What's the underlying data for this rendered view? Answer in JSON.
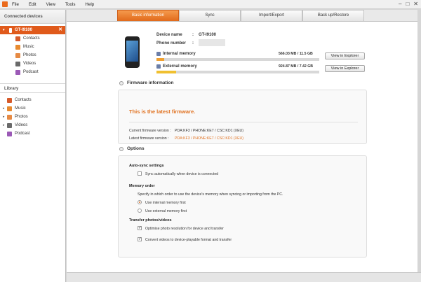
{
  "menubar": {
    "items": [
      "File",
      "Edit",
      "View",
      "Tools",
      "Help"
    ]
  },
  "window_controls": {
    "minimize": "–",
    "maximize": "□",
    "close": "✕"
  },
  "sidebar": {
    "connected_header": "Connected devices",
    "device": {
      "name": "GT-I9100",
      "close_glyph": "✕"
    },
    "device_items": [
      {
        "label": "Contacts",
        "icon": "contacts-icon",
        "color": "#d65a2a"
      },
      {
        "label": "Music",
        "icon": "music-icon",
        "color": "#e88a2f"
      },
      {
        "label": "Photos",
        "icon": "photos-icon",
        "color": "#e68a44"
      },
      {
        "label": "Videos",
        "icon": "videos-icon",
        "color": "#6a6a6a"
      },
      {
        "label": "Podcast",
        "icon": "podcast-icon",
        "color": "#9b59b6"
      }
    ],
    "library_header": "Library",
    "library_items": [
      {
        "label": "Contacts",
        "icon": "contacts-icon",
        "color": "#d65a2a",
        "expandable": false
      },
      {
        "label": "Music",
        "icon": "music-icon",
        "color": "#e88a2f",
        "expandable": true
      },
      {
        "label": "Photos",
        "icon": "photos-icon",
        "color": "#e68a44",
        "expandable": true
      },
      {
        "label": "Videos",
        "icon": "videos-icon",
        "color": "#6a6a6a",
        "expandable": true
      },
      {
        "label": "Podcast",
        "icon": "podcast-icon",
        "color": "#9b59b6",
        "expandable": false
      }
    ]
  },
  "tabs": [
    {
      "label": "Basic information",
      "active": true
    },
    {
      "label": "Sync",
      "active": false
    },
    {
      "label": "Import/Export",
      "active": false
    },
    {
      "label": "Back up/Restore",
      "active": false
    }
  ],
  "device_info": {
    "name_label": "Device name",
    "name_value": "GT-I9100",
    "phone_label": "Phone number",
    "separator": ":"
  },
  "memory": {
    "internal": {
      "label": "Internal memory",
      "value": "566.03 MB / 11.5 GB",
      "fill_fraction": 0.049,
      "color": "#f0a030"
    },
    "external": {
      "label": "External memory",
      "value": "924.87 MB / 7.42 GB",
      "fill_fraction": 0.122,
      "color": "#f0c030"
    }
  },
  "buttons": {
    "view_explorer_1": "View in Explorer",
    "view_explorer_2": "View in Explorer"
  },
  "firmware": {
    "section_title": "Firmware information",
    "status": "This is the latest firmware.",
    "current_label": "Current firmware version :",
    "current_value": "PDA:KF3 / PHONE:KE7 / CSC:KD1 (XEU)",
    "latest_label": "Latest firmware version :",
    "latest_value": "PDA:KF3 / PHONE:KE7 / CSC:KD1 (XEU)"
  },
  "options": {
    "section_title": "Options",
    "autosync_title": "Auto-sync settings",
    "autosync_label": "Sync automatically when device is connected",
    "autosync_checked": false,
    "memory_order_title": "Memory order",
    "memory_order_desc": "Specify in which order to use the device's memory when syncing or importing from the PC.",
    "radio_internal": "Use internal memory first",
    "radio_external": "Use external memory first",
    "transfer_title": "Transfer photos/videos",
    "optimise_label": "Optimise photo resolution for device and transfer",
    "convert_label": "Convert videos to device-playable format and transfer",
    "check_glyph": "✓"
  },
  "accent_color": "#e0701e"
}
